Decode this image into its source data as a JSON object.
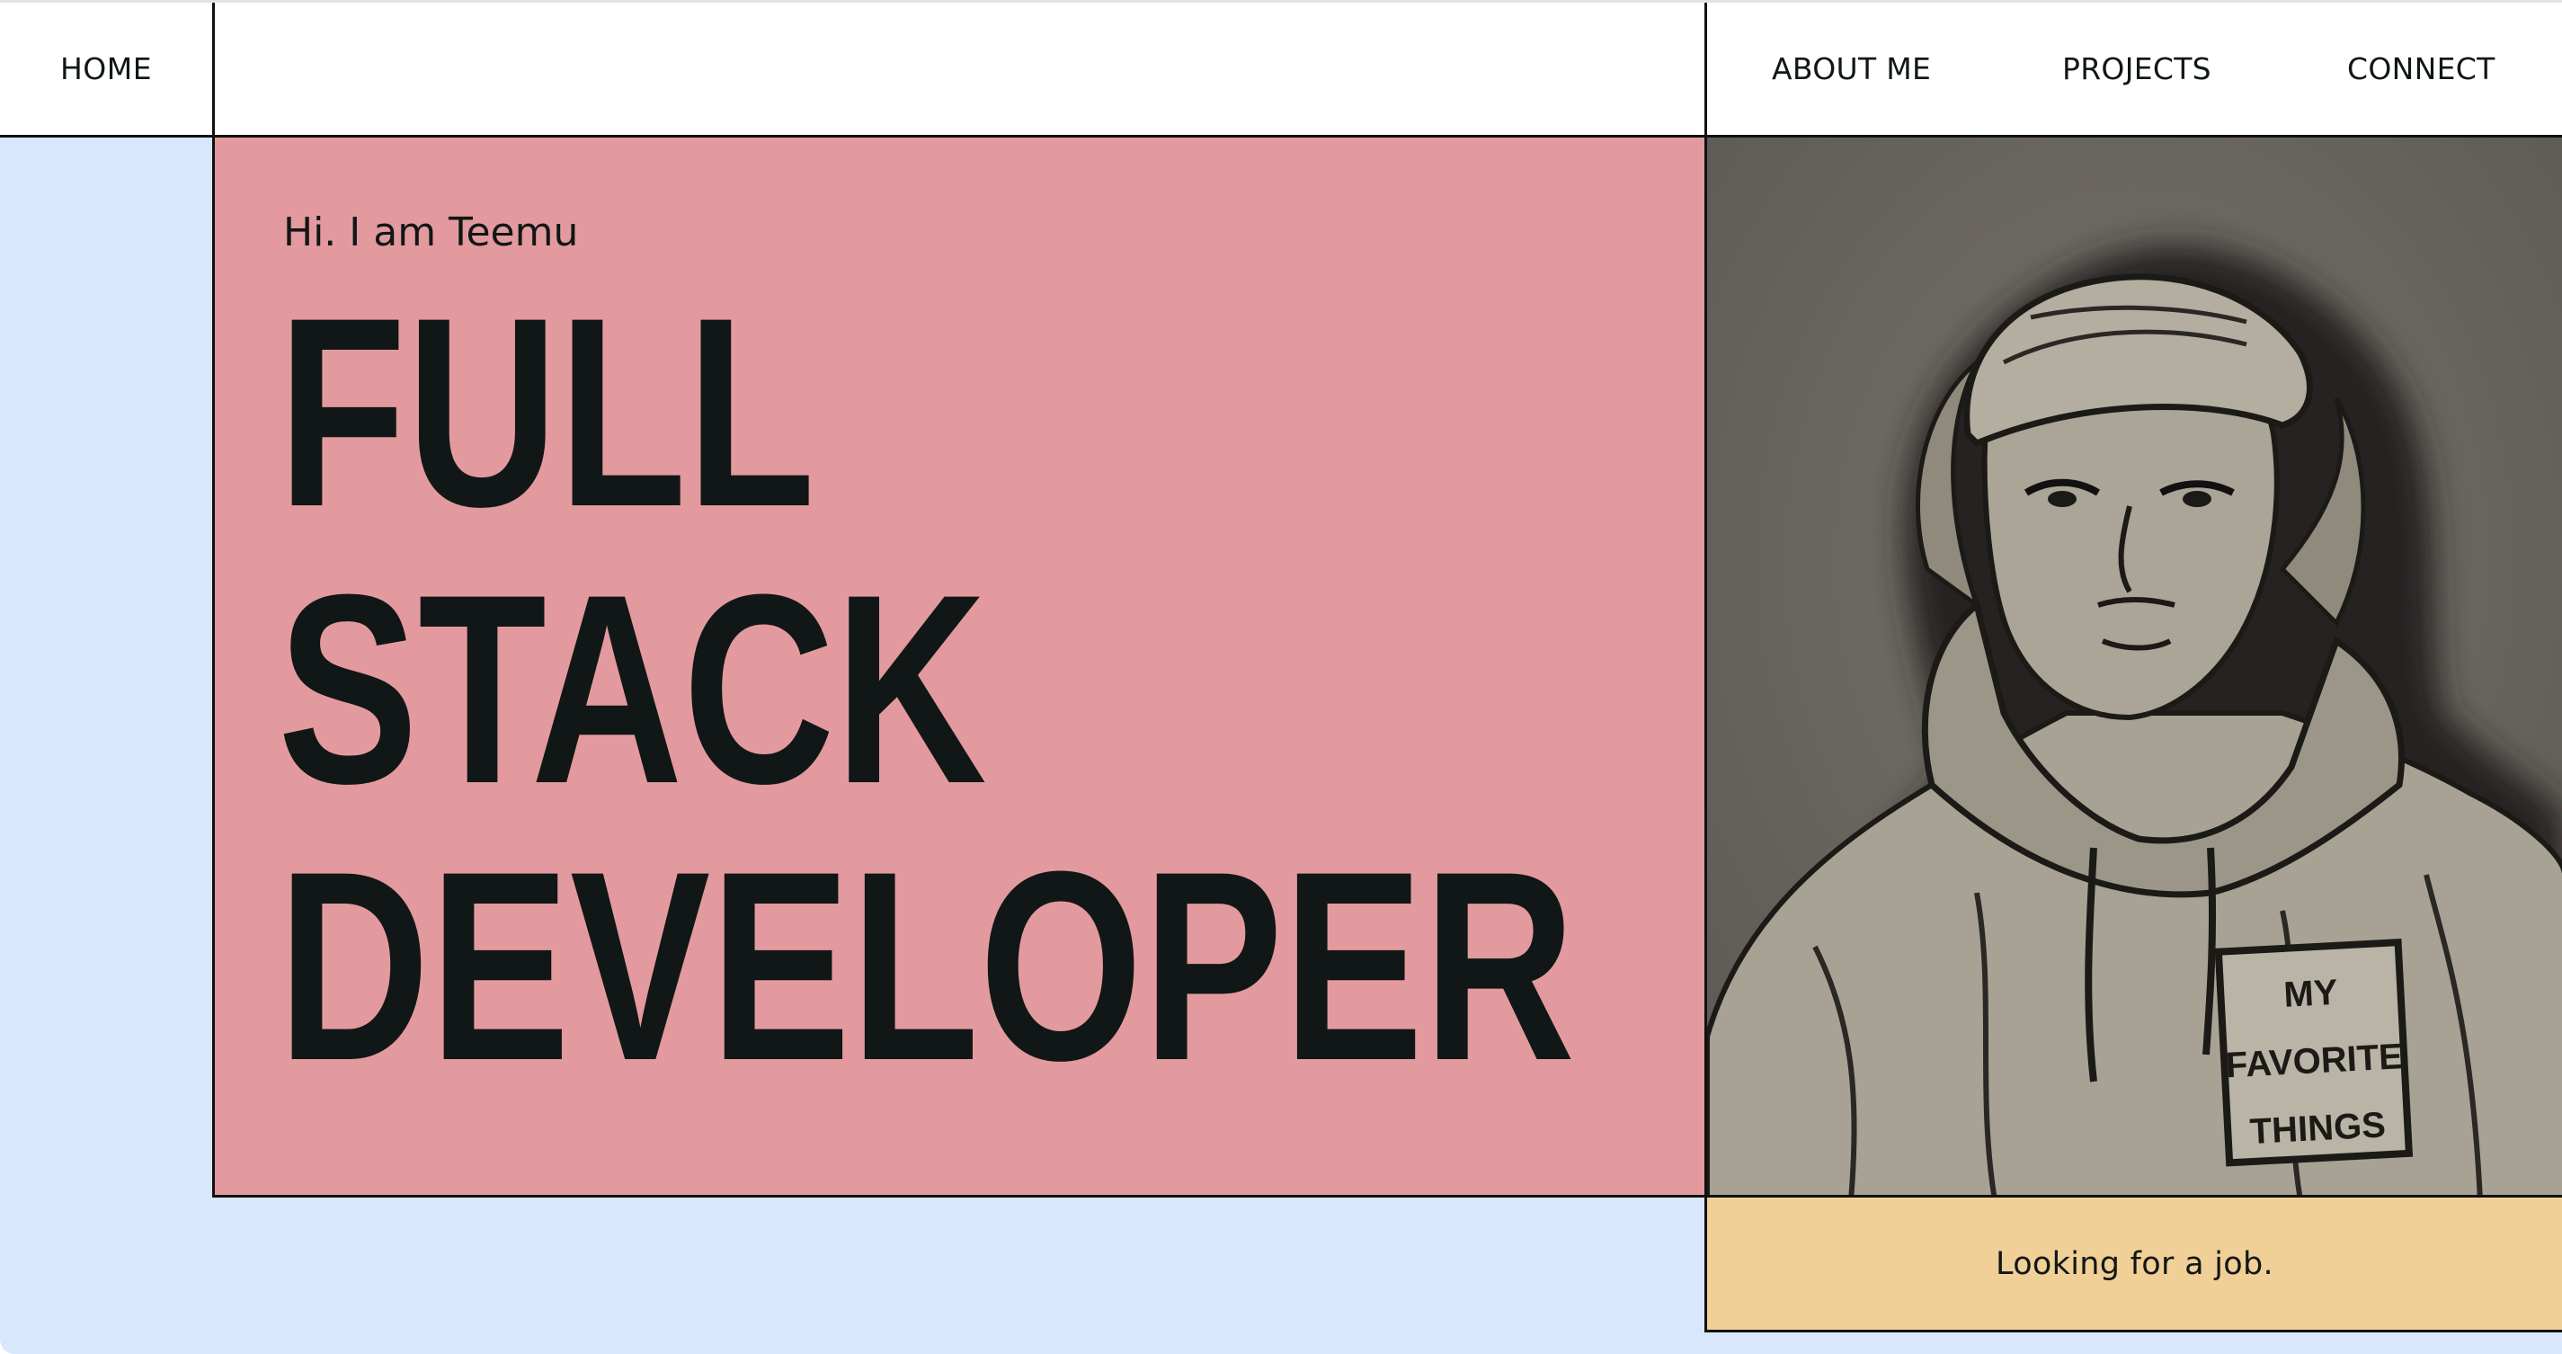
{
  "nav": {
    "home_label": "HOME",
    "links": [
      {
        "label": "ABOUT ME"
      },
      {
        "label": "PROJECTS"
      },
      {
        "label": "CONNECT"
      }
    ]
  },
  "hero": {
    "greeting": "Hi. I am Teemu",
    "headline_lines": [
      "FULL",
      "STACK",
      "DEVELOPER"
    ]
  },
  "portrait": {
    "shirt_text": [
      "MY",
      "FAVORITE",
      "THINGS"
    ]
  },
  "status": {
    "text": "Looking for a job."
  },
  "colors": {
    "nav_bg": "#ffffff",
    "page_bg": "#d8e7fb",
    "hero_bg": "#e39a9e",
    "status_bg": "#f0d096",
    "border": "#111111",
    "text": "#111716"
  }
}
